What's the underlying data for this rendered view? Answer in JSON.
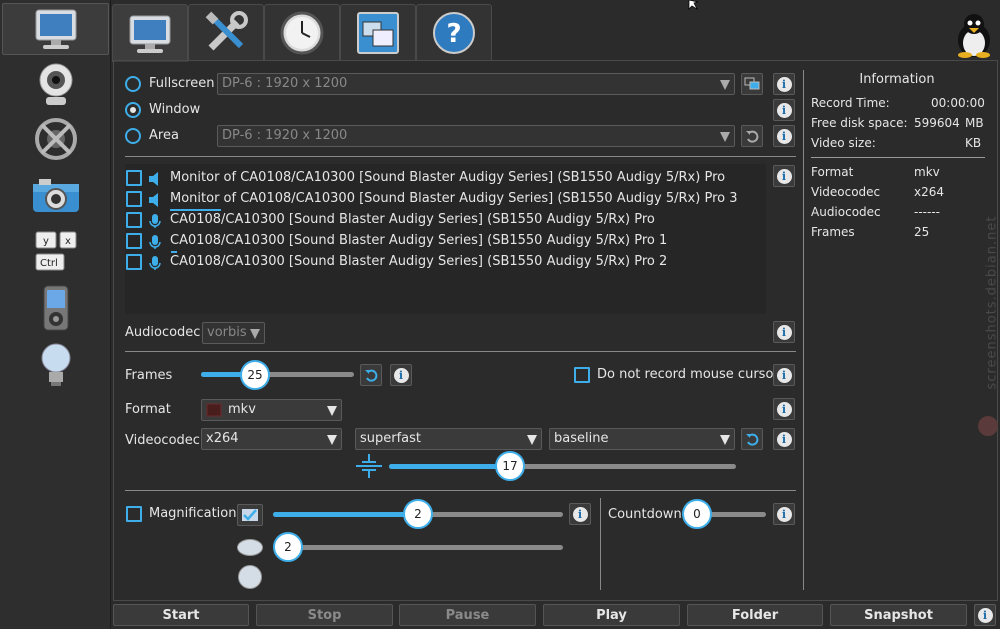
{
  "tabs": [
    {
      "name": "screen",
      "icon": "monitor-icon"
    },
    {
      "name": "settings",
      "icon": "tools-icon"
    },
    {
      "name": "timer",
      "icon": "clock-icon"
    },
    {
      "name": "windows",
      "icon": "windows-icon"
    },
    {
      "name": "help",
      "icon": "question-icon"
    }
  ],
  "sidebar": [
    "monitor-icon",
    "webcam-icon",
    "no-webcam-icon",
    "camera-icon",
    "keyboard-icon",
    "player-icon",
    "bulb-icon"
  ],
  "keyboard_keys": {
    "y": "y",
    "x": "x",
    "ctrl": "Ctrl"
  },
  "screen": {
    "fullscreen_label": "Fullscreen",
    "window_label": "Window",
    "area_label": "Area",
    "fullscreen_value": "DP-6 :  1920 x 1200",
    "area_value": "DP-6 :  1920 x 1200",
    "selected": "window"
  },
  "audio_devices": [
    {
      "type": "speaker",
      "label": "Monitor of CA0108/CA10300 [Sound Blaster Audigy Series] (SB1550 Audigy 5/Rx) Pro"
    },
    {
      "type": "speaker",
      "label": "Monitor of CA0108/CA10300 [Sound Blaster Audigy Series] (SB1550 Audigy 5/Rx) Pro 3"
    },
    {
      "type": "mic",
      "label": "CA0108/CA10300 [Sound Blaster Audigy Series] (SB1550 Audigy 5/Rx) Pro"
    },
    {
      "type": "mic",
      "label": "CA0108/CA10300 [Sound Blaster Audigy Series] (SB1550 Audigy 5/Rx) Pro 1"
    },
    {
      "type": "mic",
      "label": "CA0108/CA10300 [Sound Blaster Audigy Series] (SB1550 Audigy 5/Rx) Pro 2"
    }
  ],
  "audiocodec": {
    "label": "Audiocodec",
    "value": "vorbis"
  },
  "frames": {
    "label": "Frames",
    "value": "25",
    "fraction": 0.35
  },
  "mouse_cursor": {
    "label": "Do not record mouse cursor"
  },
  "format": {
    "label": "Format",
    "value": "mkv"
  },
  "videocodec": {
    "label": "Videocodec",
    "codec": "x264",
    "preset": "superfast",
    "profile": "baseline",
    "quality": "17",
    "quality_fraction": 0.35
  },
  "magnification": {
    "label": "Magnification",
    "value1": "2",
    "fraction1": 0.5,
    "value2": "2",
    "fraction2": 0.0
  },
  "countdown": {
    "label": "Countdown",
    "value": "0",
    "fraction": 0.0
  },
  "information": {
    "title": "Information",
    "record_time_label": "Record Time:",
    "record_time": "00:00:00",
    "disk_label": "Free disk space:",
    "disk_value": "599604",
    "disk_unit": "MB",
    "video_size_label": "Video size:",
    "video_size_unit": "KB",
    "format_label": "Format",
    "format_value": "mkv",
    "videocodec_label": "Videocodec",
    "videocodec_value": "x264",
    "audiocodec_label": "Audiocodec",
    "audiocodec_value": "------",
    "frames_label": "Frames",
    "frames_value": "25"
  },
  "buttons": {
    "start": "Start",
    "stop": "Stop",
    "pause": "Pause",
    "play": "Play",
    "folder": "Folder",
    "snapshot": "Snapshot"
  },
  "watermark": "screenshots.debian.net",
  "info_glyph": "i"
}
